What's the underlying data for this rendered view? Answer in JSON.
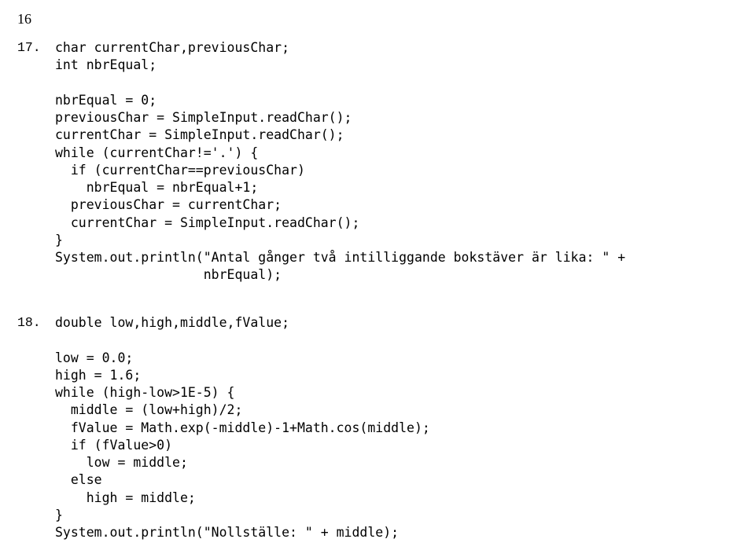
{
  "page_number": "16",
  "item17": {
    "label": "17.",
    "line0": "char currentChar,previousChar;",
    "line1": "int nbrEqual;",
    "line2": "",
    "line3": "nbrEqual = 0;",
    "line4": "previousChar = SimpleInput.readChar();",
    "line5": "currentChar = SimpleInput.readChar();",
    "line6": "while (currentChar!='.') {",
    "line7": "  if (currentChar==previousChar)",
    "line8": "    nbrEqual = nbrEqual+1;",
    "line9": "  previousChar = currentChar;",
    "line10": "  currentChar = SimpleInput.readChar();",
    "line11": "}",
    "line12": "System.out.println(\"Antal gånger två intilliggande bokstäver är lika: \" +",
    "line13": "                   nbrEqual);"
  },
  "item18": {
    "label": "18.",
    "line0": "double low,high,middle,fValue;",
    "line1": "",
    "line2": "low = 0.0;",
    "line3": "high = 1.6;",
    "line4": "while (high-low>1E-5) {",
    "line5": "  middle = (low+high)/2;",
    "line6": "  fValue = Math.exp(-middle)-1+Math.cos(middle);",
    "line7": "  if (fValue>0)",
    "line8": "    low = middle;",
    "line9": "  else",
    "line10": "    high = middle;",
    "line11": "}",
    "line12": "System.out.println(\"Nollställe: \" + middle);"
  }
}
